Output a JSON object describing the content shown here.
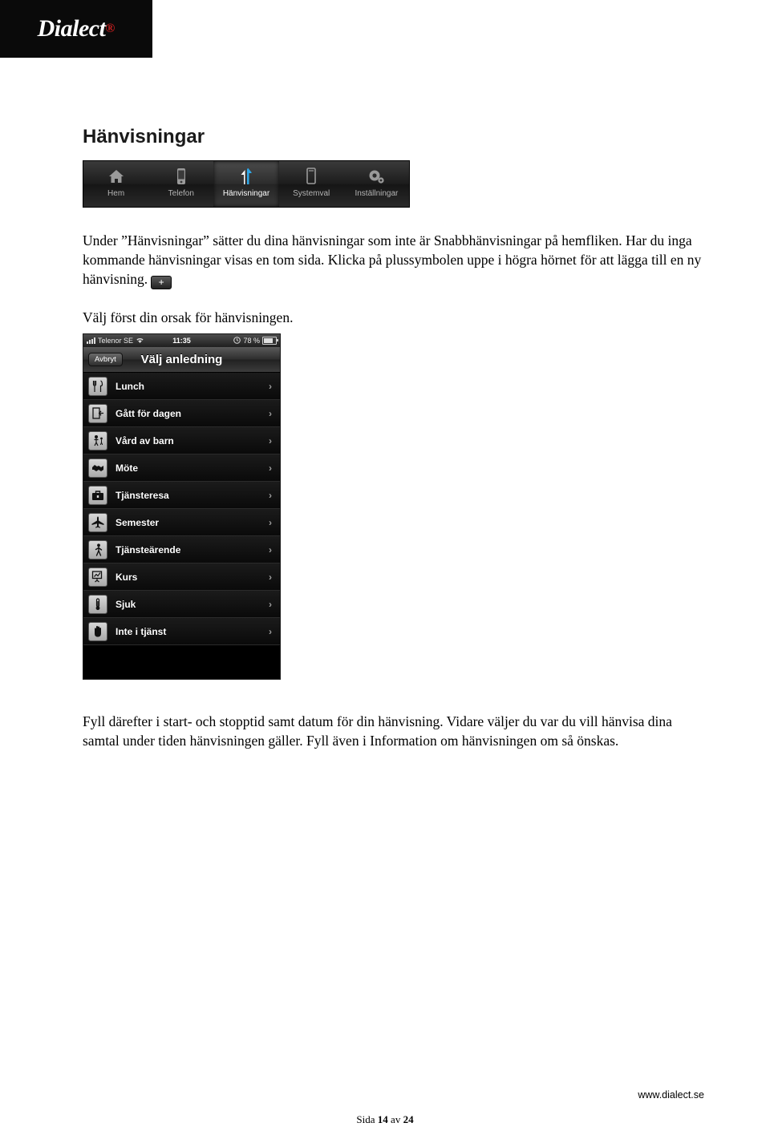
{
  "logo": {
    "name": "Dialect",
    "registered_mark": "®"
  },
  "heading": "Hänvisningar",
  "tabbar": {
    "tabs": [
      {
        "label": "Hem",
        "icon": "home-icon",
        "selected": false
      },
      {
        "label": "Telefon",
        "icon": "phone-icon",
        "selected": false
      },
      {
        "label": "Hänvisningar",
        "icon": "arrows-icon",
        "selected": true
      },
      {
        "label": "Systemval",
        "icon": "device-icon",
        "selected": false
      },
      {
        "label": "Inställningar",
        "icon": "gear-icon",
        "selected": false
      }
    ]
  },
  "body": {
    "para1_a": "Under ”Hänvisningar” sätter du dina hänvisningar som inte är Snabbhänvisningar på hemfliken. Har du inga kommande hänvisningar visas en tom sida. Klicka på plussymbolen uppe i högra hörnet för att lägga till en ny hänvisning.",
    "plus_symbol": "+",
    "para2": "Välj först din orsak för hänvisningen.",
    "para3": "Fyll därefter i start- och stopptid samt datum för din hänvisning. Vidare väljer du var du vill hänvisa dina samtal under tiden hänvisningen gäller. Fyll även i Information om hänvisningen om så önskas."
  },
  "phone": {
    "status": {
      "carrier": "Telenor SE",
      "time": "11:35",
      "battery": "78 %"
    },
    "nav": {
      "back_label": "Avbryt",
      "title": "Välj anledning"
    },
    "rows": [
      {
        "label": "Lunch",
        "icon": "cutlery-icon"
      },
      {
        "label": "Gått för dagen",
        "icon": "exit-door-icon"
      },
      {
        "label": "Vård av barn",
        "icon": "parent-child-icon"
      },
      {
        "label": "Möte",
        "icon": "handshake-icon"
      },
      {
        "label": "Tjänsteresa",
        "icon": "briefcase-icon"
      },
      {
        "label": "Semester",
        "icon": "airplane-icon"
      },
      {
        "label": "Tjänsteärende",
        "icon": "walking-person-icon"
      },
      {
        "label": "Kurs",
        "icon": "presentation-icon"
      },
      {
        "label": "Sjuk",
        "icon": "thermometer-icon"
      },
      {
        "label": "Inte i tjänst",
        "icon": "hand-stop-icon"
      }
    ],
    "chevron": "›"
  },
  "footer": {
    "url": "www.dialect.se",
    "page_prefix": "Sida ",
    "page_number": "14",
    "page_middle": " av ",
    "page_total": "24"
  }
}
